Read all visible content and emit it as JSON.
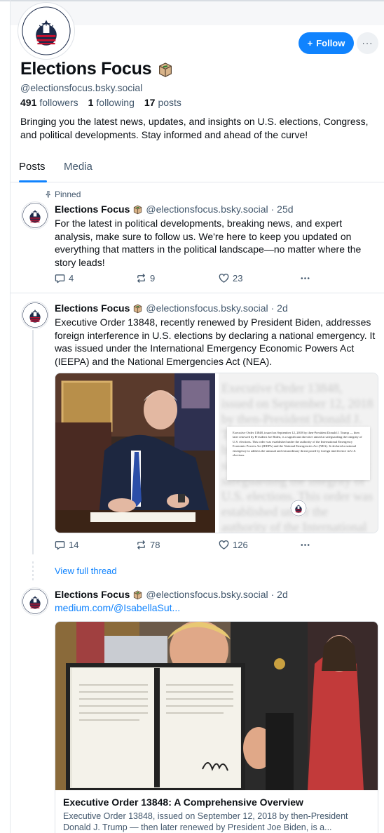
{
  "profile": {
    "display_name": "Elections Focus",
    "handle": "@electionsfocus.bsky.social",
    "followers_count": "491",
    "followers_label": "followers",
    "following_count": "1",
    "following_label": "following",
    "posts_count": "17",
    "posts_label": "posts",
    "bio": "Bringing you the latest news, updates, and insights on U.S. elections, Congress, and political developments. Stay informed and ahead of the curve!",
    "follow_label": "Follow",
    "more_label": "···",
    "avatar_text": "ELECTIONS FOCUS"
  },
  "tabs": [
    {
      "label": "Posts",
      "active": true
    },
    {
      "label": "Media",
      "active": false
    }
  ],
  "posts": [
    {
      "pinned_label": "Pinned",
      "author": "Elections Focus",
      "handle": "@electionsfocus.bsky.social",
      "time": "· 25d",
      "text": "For the latest in political developments, breaking news, and expert analysis, make sure to follow us. We're here to keep you updated on everything that matters in the political landscape—no matter where the story leads!",
      "replies": "4",
      "reposts": "9",
      "likes": "23"
    },
    {
      "author": "Elections Focus",
      "handle": "@electionsfocus.bsky.social",
      "time": "· 2d",
      "text": "Executive Order 13848, recently renewed by President Biden, addresses foreign interference in U.S. elections by declaring a national emergency. It was issued under the International Emergency Economic Powers Act (IEEPA) and the National Emergencies Act (NEA).",
      "replies": "14",
      "reposts": "78",
      "likes": "126",
      "doc_text": "Executive Order 13848, issued on September 12, 2018 by then-President Donald J. Trump — then later renewed by President Joe Biden, is a significant directive aimed at safeguarding the integrity of U.S. elections. This order was established under the authority of the International Emergency Economic Powers Act (IEEPA) and the National Emergencies Act (NEA). It declared a national emergency to address the unusual and extraordinary threat posed by foreign interference in U.S. elections.",
      "view_thread": "View full thread"
    },
    {
      "author": "Elections Focus",
      "handle": "@electionsfocus.bsky.social",
      "time": "· 2d",
      "link": "medium.com/@IsabellaSut...",
      "card_title": "Executive Order 13848: A Comprehensive Overview",
      "card_desc": "Executive Order 13848, issued on September 12, 2018 by then-President Donald J. Trump — then later renewed by President Joe Biden, is a..."
    }
  ],
  "icons": {
    "ballot": "ballot-box-icon",
    "reply": "reply-icon",
    "repost": "repost-icon",
    "like": "heart-icon",
    "more": "more-icon",
    "pin": "pin-icon",
    "plus": "plus-icon"
  },
  "colors": {
    "accent": "#1083fe",
    "muted": "#42576c",
    "border": "#e3e7ec",
    "logo_red": "#c8102e",
    "logo_navy": "#1c2b4a"
  }
}
